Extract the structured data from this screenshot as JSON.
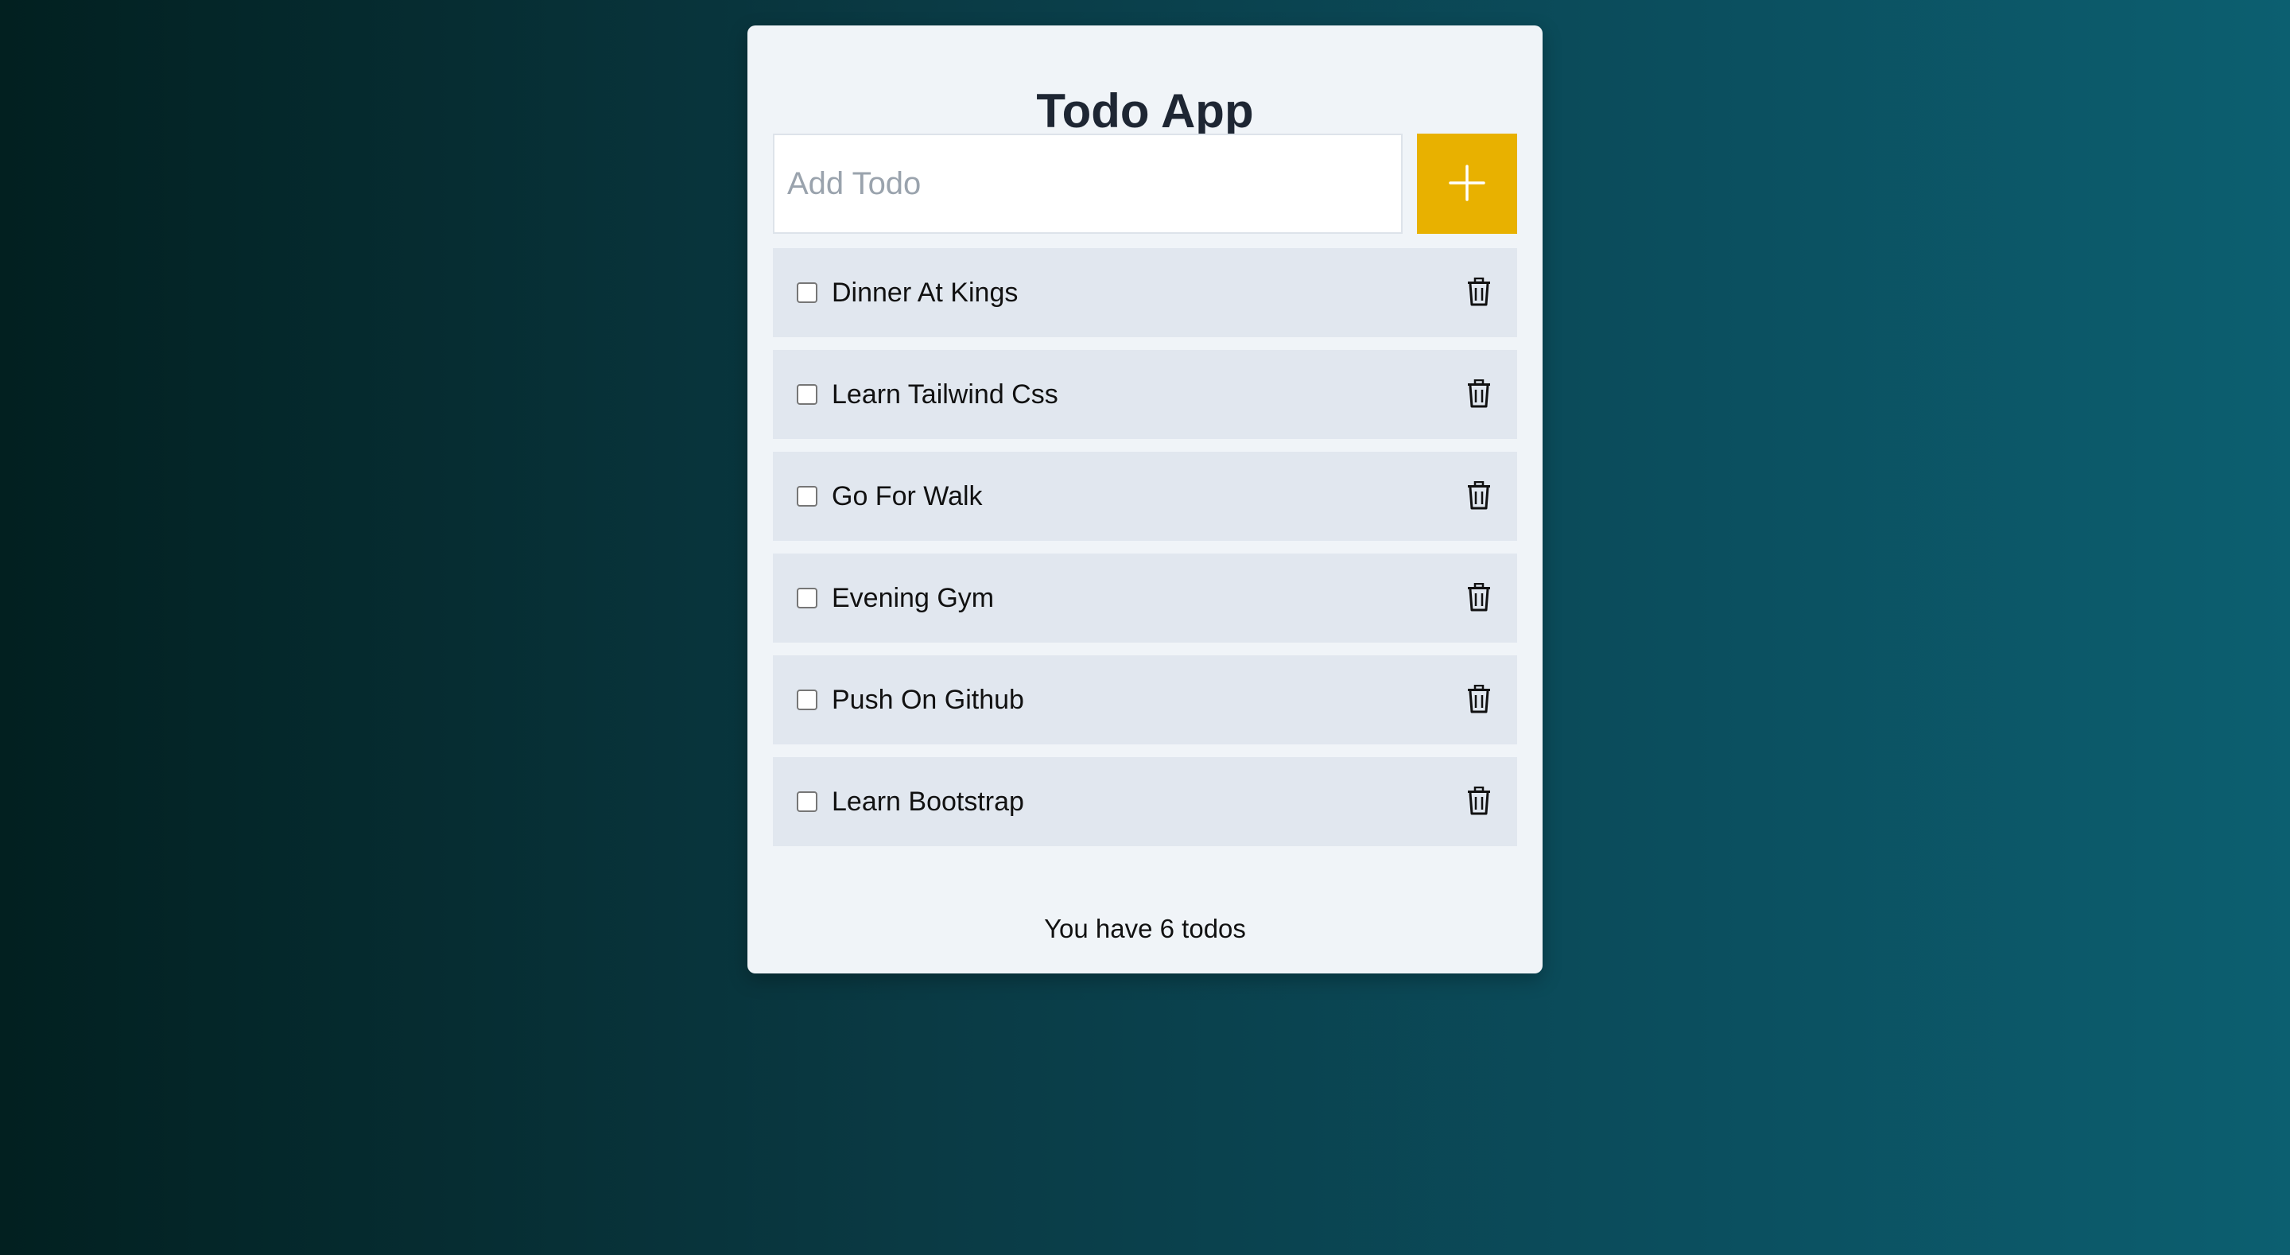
{
  "app": {
    "title": "Todo App"
  },
  "add_form": {
    "placeholder": "Add Todo",
    "value": "",
    "button_icon": "plus-icon",
    "button_color": "#e8b100"
  },
  "todos": [
    {
      "label": "Dinner At Kings",
      "checked": false,
      "delete_icon": "trash-icon"
    },
    {
      "label": "Learn Tailwind Css",
      "checked": false,
      "delete_icon": "trash-icon"
    },
    {
      "label": "Go For Walk",
      "checked": false,
      "delete_icon": "trash-icon"
    },
    {
      "label": "Evening Gym",
      "checked": false,
      "delete_icon": "trash-icon"
    },
    {
      "label": "Push On Github",
      "checked": false,
      "delete_icon": "trash-icon"
    },
    {
      "label": "Learn Bootstrap",
      "checked": false,
      "delete_icon": "trash-icon"
    }
  ],
  "footer": {
    "count_text": "You have 6 todos"
  },
  "colors": {
    "card_background": "#f0f4f8",
    "item_background": "#e1e7ef",
    "title_color": "#1e2633"
  }
}
